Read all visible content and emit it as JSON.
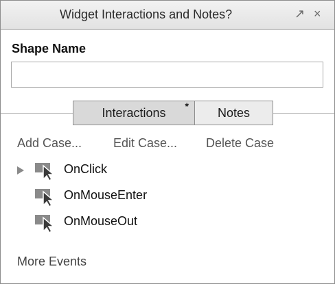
{
  "panel": {
    "title": "Widget Interactions and Notes?",
    "icons": [
      "pin-icon",
      "close-icon"
    ]
  },
  "shape_name": {
    "label": "Shape Name",
    "value": "",
    "placeholder": ""
  },
  "tabs": [
    {
      "label": "Interactions",
      "marker": "*",
      "selected": true
    },
    {
      "label": "Notes",
      "selected": false
    }
  ],
  "case_actions": [
    {
      "label": "Add Case..."
    },
    {
      "label": "Edit Case..."
    },
    {
      "label": "Delete Case"
    }
  ],
  "events": [
    {
      "label": "OnClick",
      "expandable": true,
      "icon": "cursor-event-icon"
    },
    {
      "label": "OnMouseEnter",
      "expandable": false,
      "icon": "cursor-event-icon"
    },
    {
      "label": "OnMouseOut",
      "expandable": false,
      "icon": "cursor-event-icon"
    }
  ],
  "more_events": "More Events",
  "colors": {
    "titlebar": "#e8e8e8",
    "tab_selected": "#d9d9d9",
    "tab_unselected": "#ececec",
    "border": "#8c8c8c",
    "icon_gray": "#8a8a8a"
  }
}
